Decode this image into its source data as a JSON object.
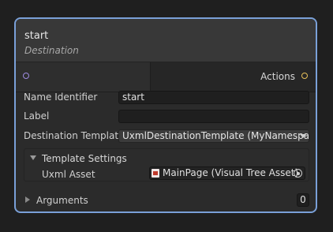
{
  "node": {
    "title": "start",
    "subtitle": "Destination",
    "output_port_label": "Actions",
    "colors": {
      "selection_border": "#7aa0d8",
      "input_port": "#9e8ce0",
      "output_port": "#e7c05a"
    }
  },
  "fields": {
    "name_identifier": {
      "label": "Name Identifier",
      "value": "start"
    },
    "label": {
      "label": "Label",
      "value": ""
    },
    "destination_template": {
      "label": "Destination Template",
      "value": "UxmlDestinationTemplate (MyNamespace)"
    }
  },
  "template_settings": {
    "header": "Template Settings",
    "uxml_asset_label": "Uxml Asset",
    "uxml_asset_value": "MainPage (Visual Tree Asset)",
    "asset_icon": "uxml-file-icon"
  },
  "arguments": {
    "label": "Arguments",
    "count": "0"
  }
}
